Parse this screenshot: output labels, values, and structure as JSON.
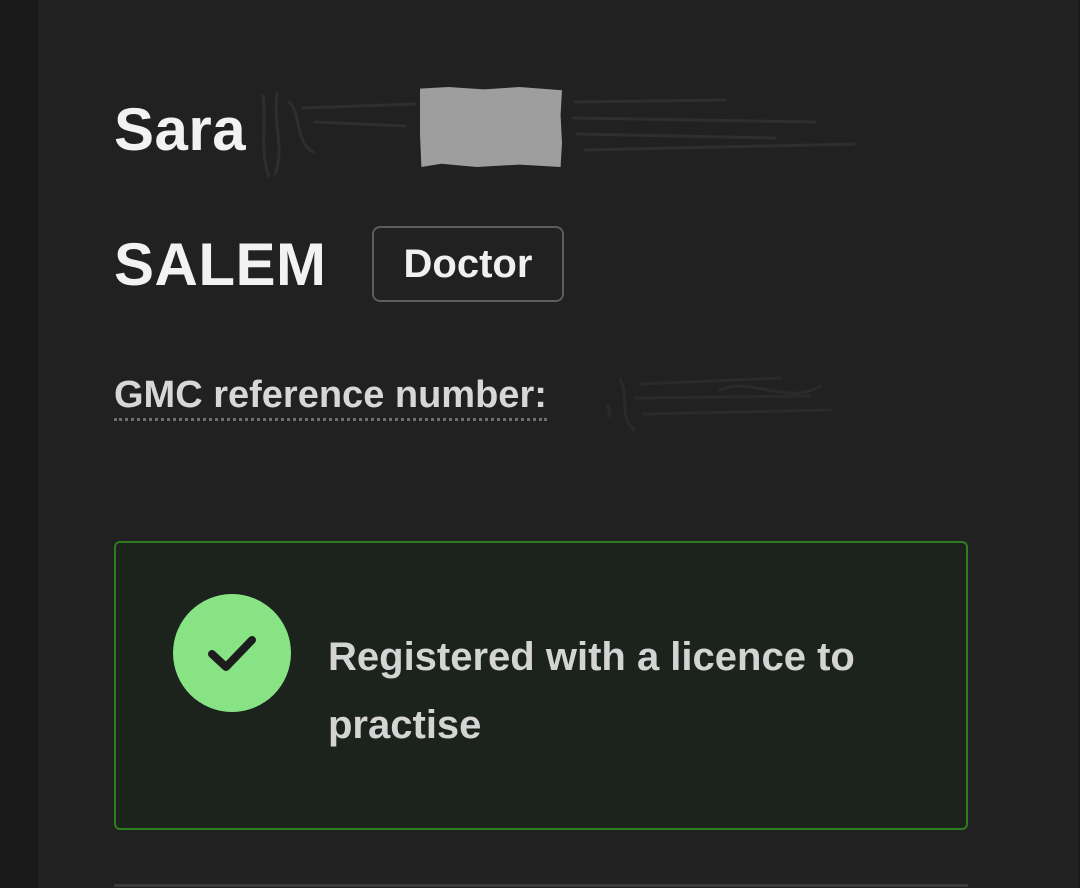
{
  "profile": {
    "first_name": "Sara",
    "last_name": "SALEM",
    "role_badge": "Doctor",
    "gmc_label": "GMC reference number:"
  },
  "status": {
    "text": "Registered with a licence to practise",
    "icon": "check-icon",
    "accent_color": "#88e384",
    "border_color": "#2e7d1f"
  },
  "colors": {
    "background": "#212121",
    "text": "#f2f2f2",
    "muted_text": "#d7d7d7"
  }
}
